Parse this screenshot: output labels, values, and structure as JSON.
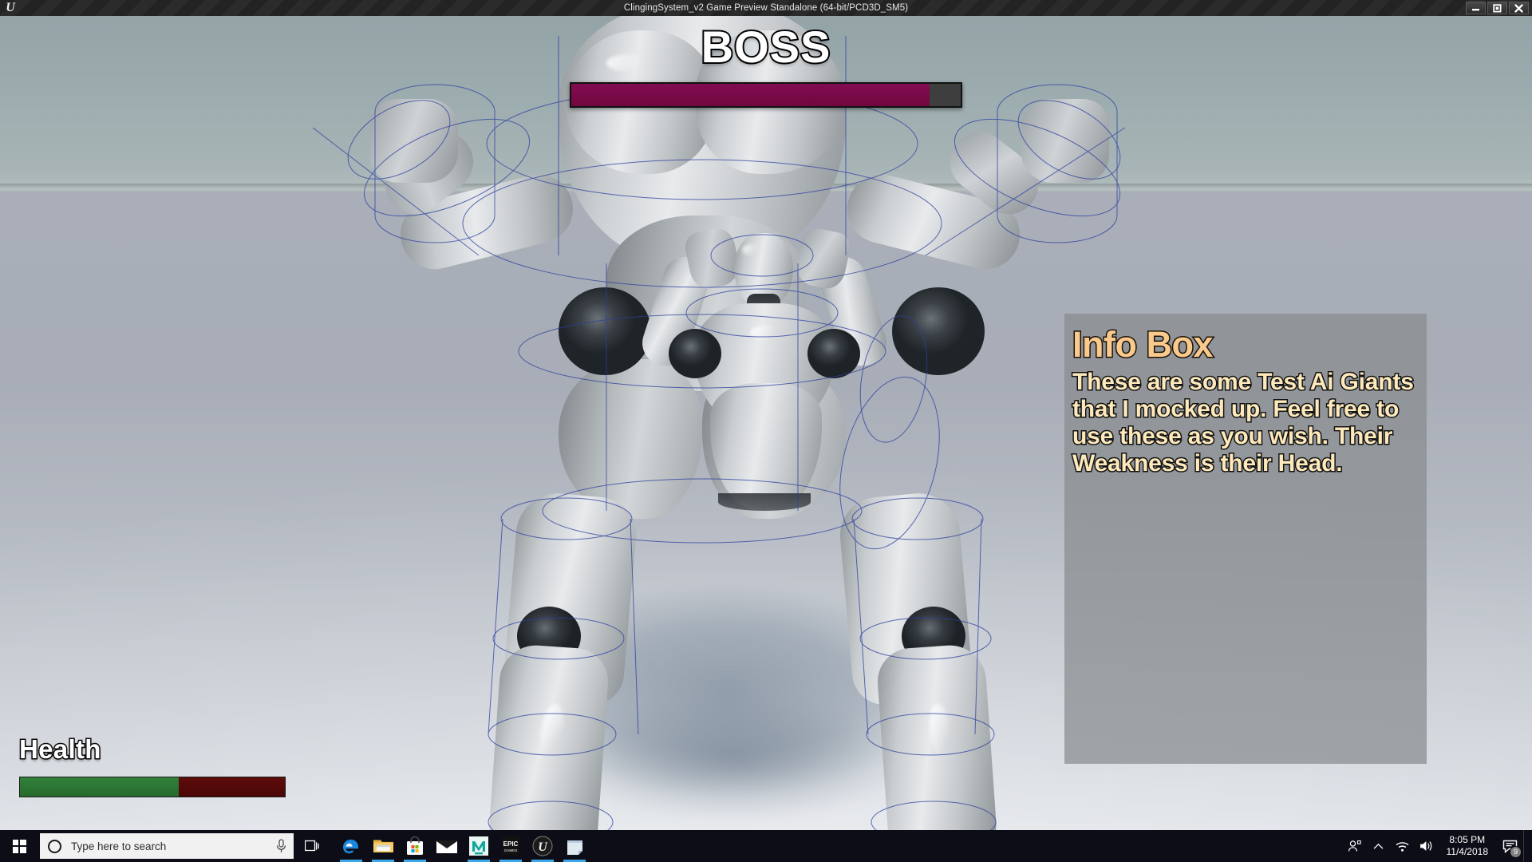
{
  "window": {
    "title": "ClingingSystem_v2 Game Preview Standalone (64-bit/PCD3D_SM5)",
    "logo_icon": "unreal-engine-icon",
    "controls": [
      {
        "name": "minimize-button",
        "icon": "minimize-icon",
        "label": "Minimize"
      },
      {
        "name": "restore-button",
        "icon": "restore-icon",
        "label": "Restore"
      },
      {
        "name": "close-button",
        "icon": "close-icon",
        "label": "Close"
      }
    ]
  },
  "hud": {
    "boss": {
      "title": "BOSS",
      "health_percent": 92,
      "fill_color": "#780a4c",
      "track_color": "#3e3e3e"
    },
    "player": {
      "label": "Health",
      "health_percent": 60,
      "fill_color": "#2e7a33",
      "track_color": "#560a0a"
    },
    "info_box": {
      "title": "Info Box",
      "body": "These are some Test Ai Giants that I mocked up. Feel free to use these as you wish. Their Weakness is their Head.",
      "title_color": "#fac98c",
      "body_color": "#fde9bb",
      "panel_color": "#888c8f"
    }
  },
  "scene": {
    "description": "Unreal Engine default mannequin giants on a light gray plane with blue collision wireframes",
    "sky_color": "#a3b1b4",
    "floor_color": "#b0b6c0",
    "wire_color": "#2b3fa0"
  },
  "taskbar": {
    "start": {
      "label": "Start",
      "icon": "windows-logo-icon"
    },
    "search": {
      "placeholder": "Type here to search",
      "icon": "search-circle-icon",
      "mic_icon": "microphone-icon"
    },
    "task_view": {
      "label": "Task View",
      "icon": "task-view-icon"
    },
    "apps": [
      {
        "name": "edge",
        "label": "Microsoft Edge",
        "icon": "edge-icon",
        "active": true
      },
      {
        "name": "file-explorer",
        "label": "File Explorer",
        "icon": "folder-icon",
        "active": true
      },
      {
        "name": "microsoft-store",
        "label": "Microsoft Store",
        "icon": "store-icon",
        "active": true
      },
      {
        "name": "mail",
        "label": "Mail",
        "icon": "mail-icon",
        "active": false
      },
      {
        "name": "mixamo",
        "label": "Mixamo",
        "icon": "mixamo-icon",
        "active": true
      },
      {
        "name": "epic-games",
        "label": "Epic Games Launcher",
        "icon": "epic-games-icon",
        "active": true
      },
      {
        "name": "unreal-engine",
        "label": "Unreal Engine",
        "icon": "unreal-engine-icon",
        "active": true
      },
      {
        "name": "sticky-notes",
        "label": "Sticky Notes",
        "icon": "sticky-notes-icon",
        "active": true
      }
    ],
    "tray": {
      "people_icon": "people-icon",
      "chevron_icon": "chevron-up-icon",
      "network_icon": "wifi-icon",
      "volume_icon": "speaker-icon",
      "time": "8:05 PM",
      "date": "11/4/2018",
      "notifications_icon": "action-center-icon",
      "notifications_count": "9"
    }
  }
}
